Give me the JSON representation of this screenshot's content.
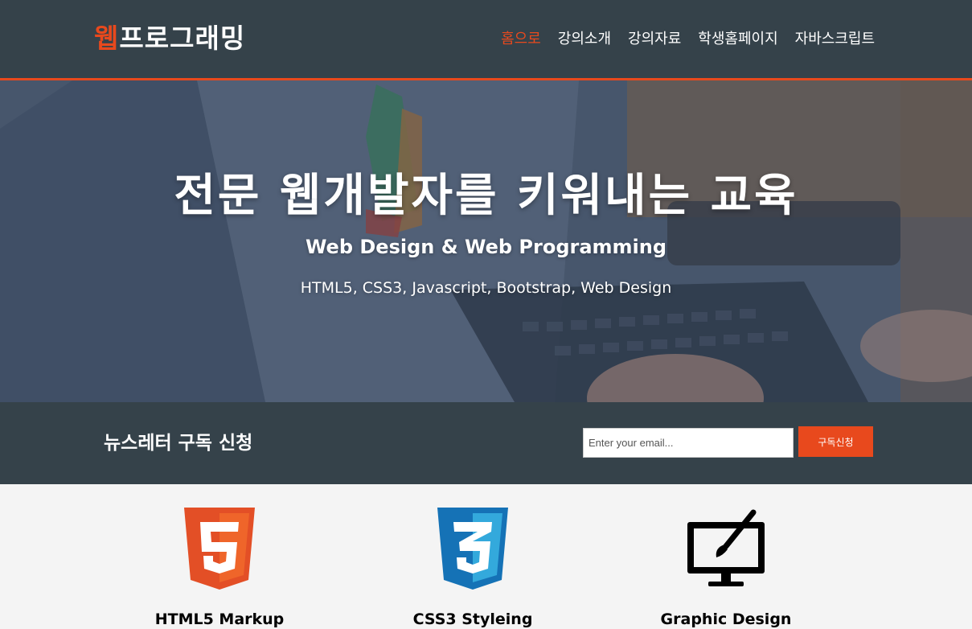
{
  "header": {
    "logo_highlight": "웹",
    "logo_rest": "프로그래밍",
    "nav": [
      {
        "label": "홈으로",
        "current": true
      },
      {
        "label": "강의소개",
        "current": false
      },
      {
        "label": "강의자료",
        "current": false
      },
      {
        "label": "학생홈페이지",
        "current": false
      },
      {
        "label": "자바스크립트",
        "current": false
      }
    ]
  },
  "hero": {
    "title": "전문 웹개발자를 키워내는 교육",
    "subtitle": "Web Design & Web Programming",
    "tags": "HTML5, CSS3, Javascript, Bootstrap, Web Design"
  },
  "newsletter": {
    "title": "뉴스레터 구독 신청",
    "input_placeholder": "Enter your email...",
    "button_label": "구독신청"
  },
  "boxes": [
    {
      "title": "HTML5 Markup",
      "icon": "html5-icon"
    },
    {
      "title": "CSS3 Styleing",
      "icon": "css3-icon"
    },
    {
      "title": "Graphic Design",
      "icon": "graphic-design-icon"
    }
  ],
  "colors": {
    "header_bg": "#35424a",
    "accent": "#e8491d",
    "section_bg": "#f4f4f4"
  }
}
